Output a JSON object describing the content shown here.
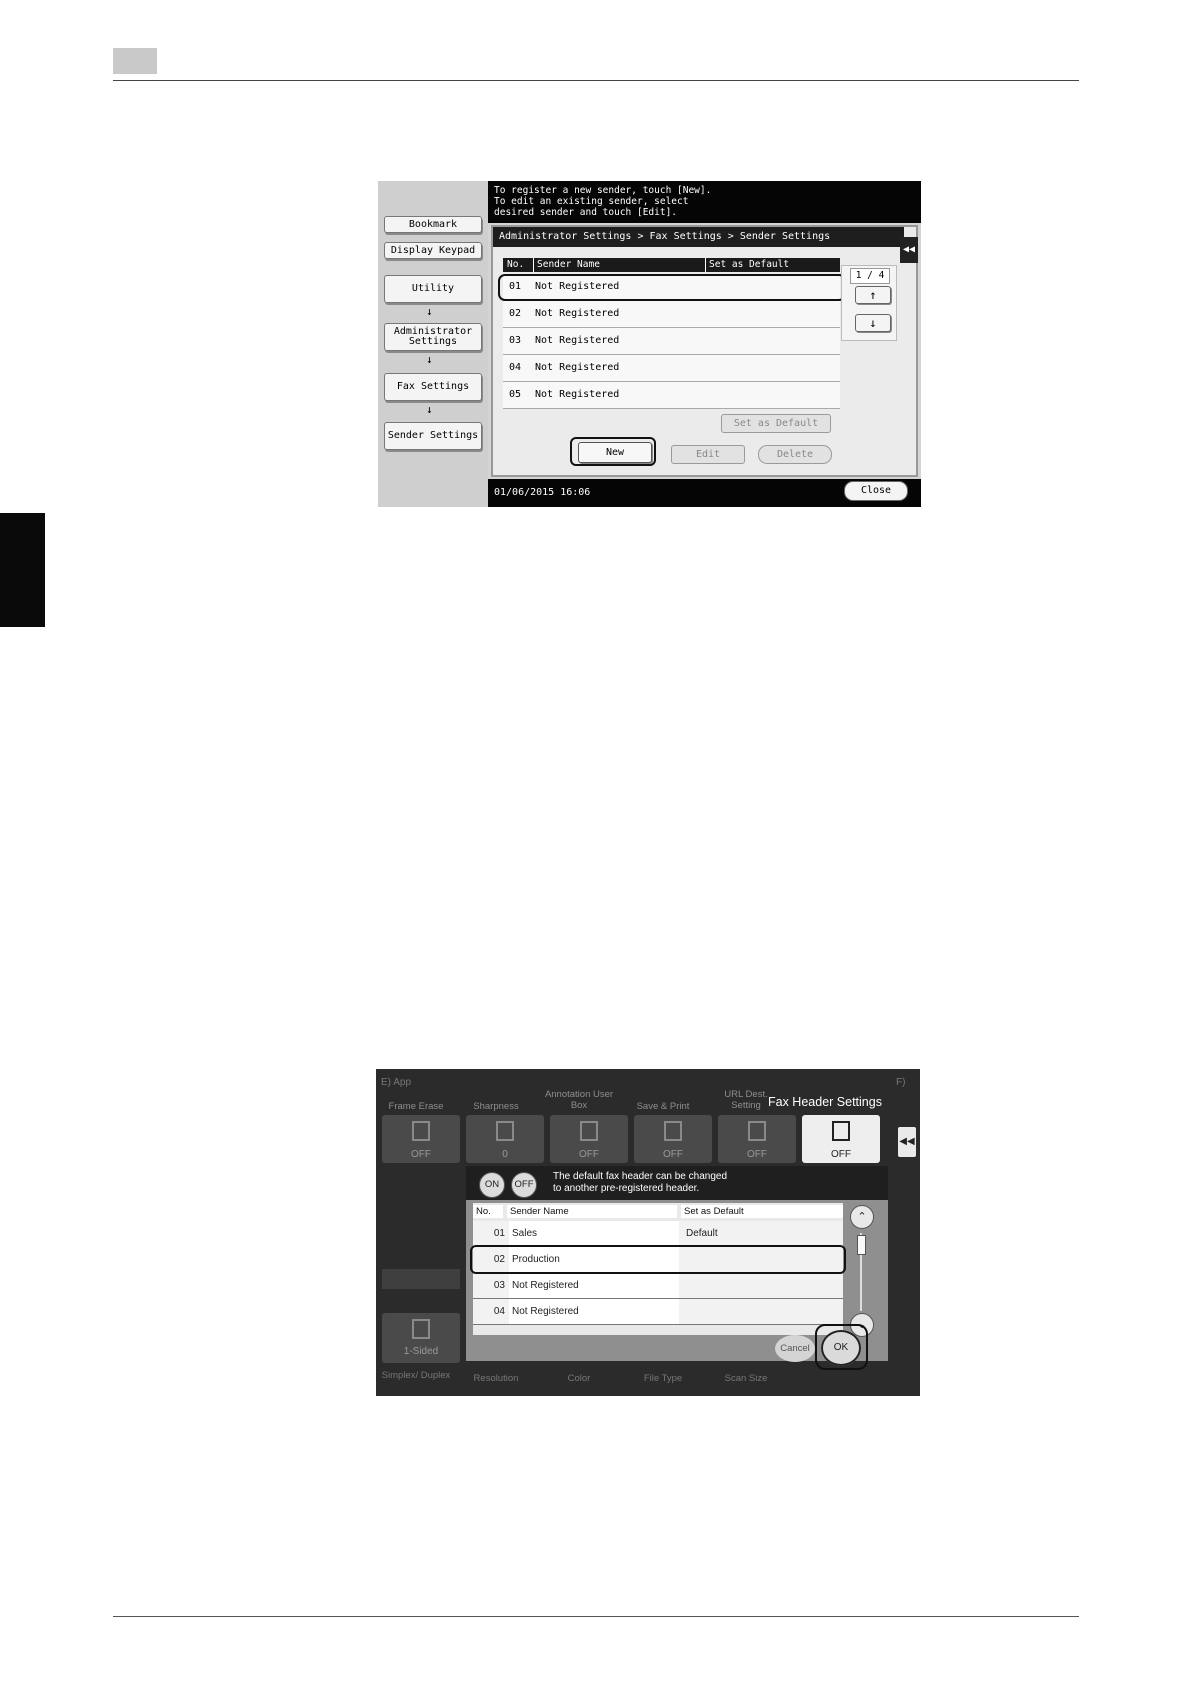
{
  "screen1": {
    "instruction": "To register a new sender, touch [New].\nTo edit an existing sender, select\ndesired sender and touch [Edit].",
    "left_buttons": {
      "bookmark": "Bookmark",
      "display_keypad": "Display Keypad",
      "utility": "Utility",
      "admin_settings": "Administrator Settings",
      "fax_settings": "Fax Settings",
      "sender_settings": "Sender Settings"
    },
    "flow_arrow": "↓",
    "breadcrumb": "Administrator Settings > Fax Settings > Sender Settings",
    "collapse_icon": "◀◀",
    "columns": {
      "no": "No.",
      "name": "Sender Name",
      "default": "Set as Default"
    },
    "rows": [
      {
        "no": "01",
        "name": "Not Registered"
      },
      {
        "no": "02",
        "name": "Not Registered"
      },
      {
        "no": "03",
        "name": "Not Registered"
      },
      {
        "no": "04",
        "name": "Not Registered"
      },
      {
        "no": "05",
        "name": "Not Registered"
      }
    ],
    "page": "1 / 4",
    "up_icon": "↑",
    "down_icon": "↓",
    "set_as_default": "Set as Default",
    "new": "New",
    "edit": "Edit",
    "delete": "Delete",
    "datetime": "01/06/2015  16:06",
    "close": "Close"
  },
  "screen2": {
    "top_labels": {
      "left": "E)  App",
      "right": "F)"
    },
    "functions": [
      {
        "label": "Frame Erase",
        "value": "OFF"
      },
      {
        "label": "Sharpness",
        "value": "0"
      },
      {
        "label": "Annotation User Box",
        "value": "OFF"
      },
      {
        "label": "Save & Print",
        "value": "OFF"
      },
      {
        "label": "URL Dest. Setting",
        "value": "OFF"
      },
      {
        "label": "",
        "value": "OFF"
      }
    ],
    "title": "Fax Header Settings",
    "collapse_icon": "◀◀",
    "on_label": "ON",
    "off_label": "OFF",
    "message": "The default fax header can be changed\nto another pre-registered header.",
    "columns": {
      "no": "No.",
      "name": "Sender Name",
      "default": "Set as Default"
    },
    "rows": [
      {
        "no": "01",
        "name": "Sales",
        "default": "Default"
      },
      {
        "no": "02",
        "name": "Production",
        "default": ""
      },
      {
        "no": "03",
        "name": "Not Registered",
        "default": ""
      },
      {
        "no": "04",
        "name": "Not Registered",
        "default": ""
      }
    ],
    "scroll_up_icon": "⌃",
    "scroll_down_icon": "⌄",
    "cancel": "Cancel",
    "ok": "OK",
    "side_value": "1-Sided",
    "bottom_labels": [
      "Simplex/ Duplex",
      "Resolution",
      "Color",
      "File Type",
      "Scan Size"
    ]
  }
}
